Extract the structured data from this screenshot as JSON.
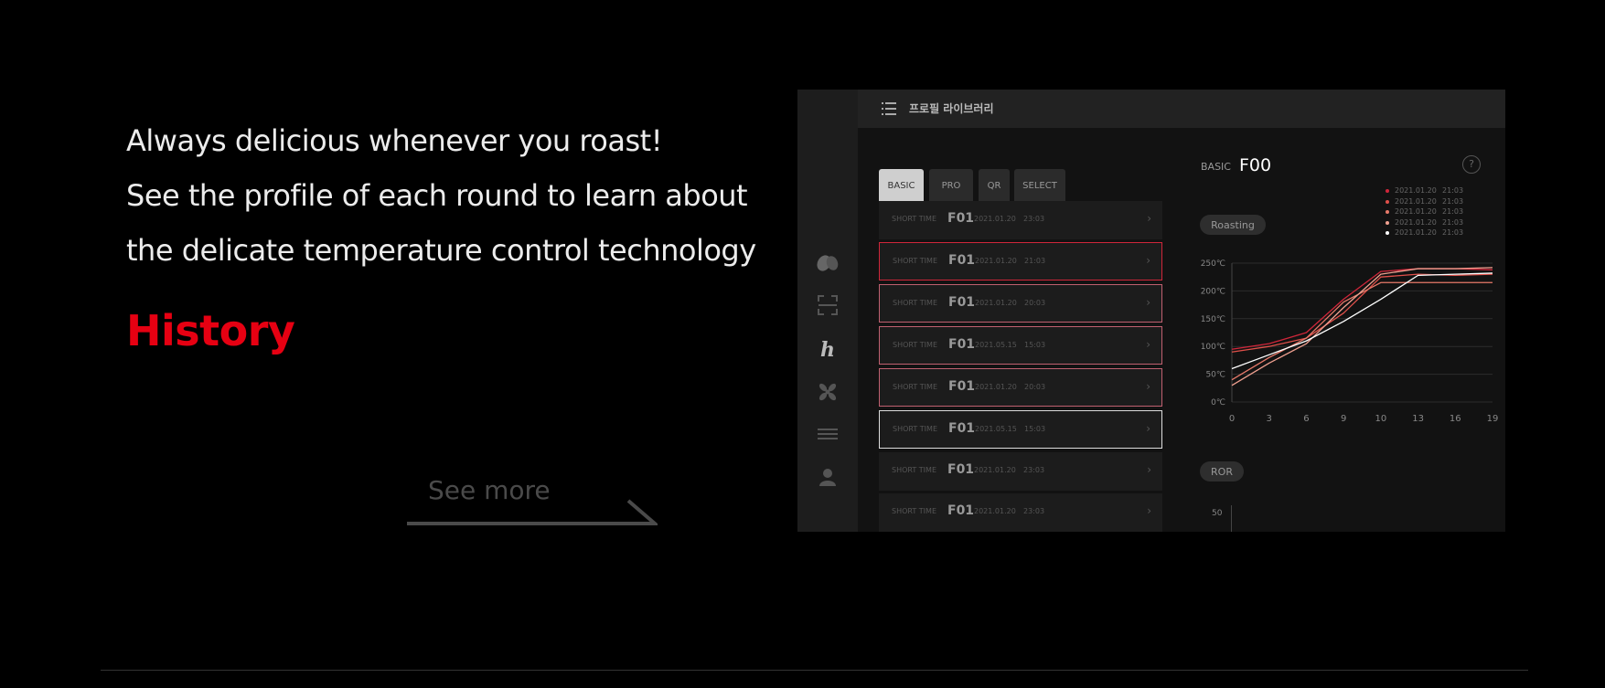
{
  "intro": {
    "lines": [
      "Always delicious whenever you roast!",
      "See the profile of each round to learn about",
      "the delicate temperature control technology"
    ],
    "section_title": "History",
    "see_more": "See more"
  },
  "app": {
    "header_title": "프로필 라이브러리",
    "sidebar_icons": [
      "bean-icon",
      "scan-icon",
      "history-icon",
      "fan-icon",
      "list-icon",
      "user-icon"
    ],
    "tabs": [
      "BASIC",
      "PRO",
      "QR",
      "SELECT"
    ],
    "active_tab": "BASIC",
    "rows": [
      {
        "label": "SHORT TIME",
        "code": "F01",
        "date": "2021.01.20",
        "time": "23:03",
        "state": "none"
      },
      {
        "label": "SHORT TIME",
        "code": "F01",
        "date": "2021.01.20",
        "time": "21:03",
        "state": "red"
      },
      {
        "label": "SHORT TIME",
        "code": "F01",
        "date": "2021.01.20",
        "time": "20:03",
        "state": "pink"
      },
      {
        "label": "SHORT TIME",
        "code": "F01",
        "date": "2021.05.15",
        "time": "15:03",
        "state": "pink"
      },
      {
        "label": "SHORT TIME",
        "code": "F01",
        "date": "2021.01.20",
        "time": "20:03",
        "state": "pink"
      },
      {
        "label": "SHORT TIME",
        "code": "F01",
        "date": "2021.05.15",
        "time": "15:03",
        "state": "white"
      },
      {
        "label": "SHORT TIME",
        "code": "F01",
        "date": "2021.01.20",
        "time": "23:03",
        "state": "none"
      },
      {
        "label": "SHORT TIME",
        "code": "F01",
        "date": "2021.01.20",
        "time": "23:03",
        "state": "none"
      }
    ],
    "detail": {
      "type": "BASIC",
      "code": "F00",
      "help": "?",
      "roasting_label": "Roasting",
      "ror_label": "ROR",
      "ror_tick": "50",
      "legend": [
        {
          "date": "2021.01.20",
          "time": "21:03",
          "color": "#d0263a"
        },
        {
          "date": "2021.01.20",
          "time": "21:03",
          "color": "#e0504a"
        },
        {
          "date": "2021.01.20",
          "time": "21:03",
          "color": "#e87a6a"
        },
        {
          "date": "2021.01.20",
          "time": "21:03",
          "color": "#f0a090"
        },
        {
          "date": "2021.01.20",
          "time": "21:03",
          "color": "#ffffff"
        }
      ]
    }
  },
  "chart_data": {
    "type": "line",
    "ylim": [
      0,
      250
    ],
    "yticks": [
      "0℃",
      "50℃",
      "100℃",
      "150℃",
      "200℃",
      "250℃"
    ],
    "xticks": [
      "0",
      "3",
      "6",
      "9",
      "10",
      "13",
      "16",
      "19"
    ],
    "series": [
      {
        "color": "#d0263a",
        "values": [
          95,
          105,
          125,
          185,
          235,
          240,
          240,
          238
        ]
      },
      {
        "color": "#e0504a",
        "values": [
          90,
          100,
          115,
          160,
          225,
          230,
          228,
          230
        ]
      },
      {
        "color": "#e87a6a",
        "values": [
          40,
          80,
          115,
          180,
          215,
          215,
          215,
          215
        ]
      },
      {
        "color": "#f0a090",
        "values": [
          30,
          70,
          105,
          170,
          230,
          240,
          240,
          242
        ]
      },
      {
        "color": "#ffffff",
        "values": [
          60,
          85,
          110,
          145,
          185,
          228,
          230,
          232
        ]
      }
    ]
  }
}
